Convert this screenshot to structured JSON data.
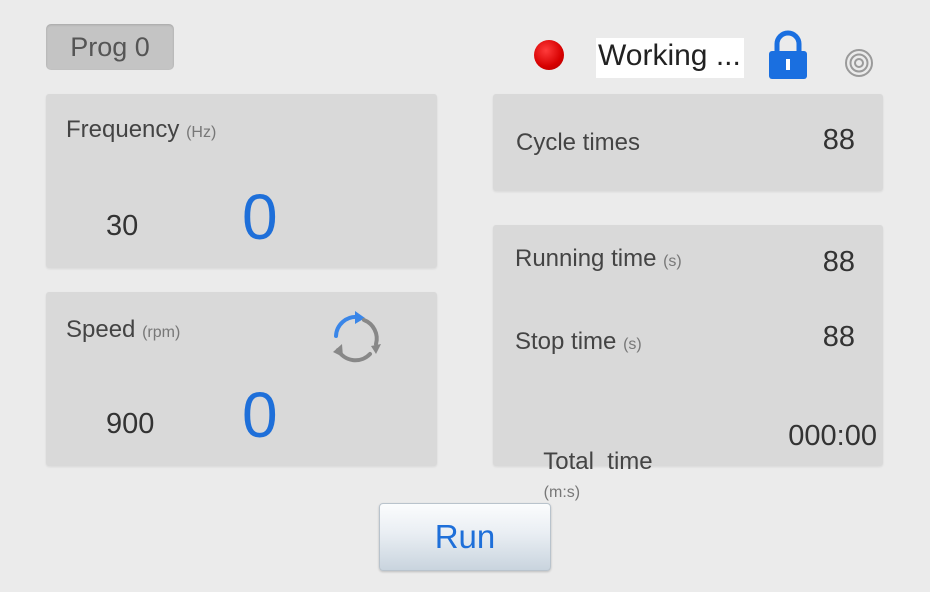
{
  "program": {
    "label": "Prog 0"
  },
  "status": {
    "text": "Working ...",
    "indicator_color": "#e00000"
  },
  "icons": {
    "lock": "lock-icon",
    "settings": "settings-icon",
    "rotate": "rotate-icon"
  },
  "frequency": {
    "label": "Frequency",
    "unit": "(Hz)",
    "set_value": "30",
    "actual_value": "0"
  },
  "speed": {
    "label": "Speed",
    "unit": "(rpm)",
    "set_value": "900",
    "actual_value": "0"
  },
  "cycle": {
    "label": "Cycle times",
    "value": "88"
  },
  "running_time": {
    "label": "Running time",
    "unit": "(s)",
    "value": "88"
  },
  "stop_time": {
    "label": "Stop time",
    "unit": "(s)",
    "value": "88"
  },
  "total_time": {
    "label": "Total  time",
    "unit": "(m:s)",
    "value": "000:00"
  },
  "run_button": {
    "label": "Run"
  },
  "colors": {
    "accent": "#1e6fd9",
    "panel": "#d9d9d9",
    "background": "#ebebeb"
  }
}
